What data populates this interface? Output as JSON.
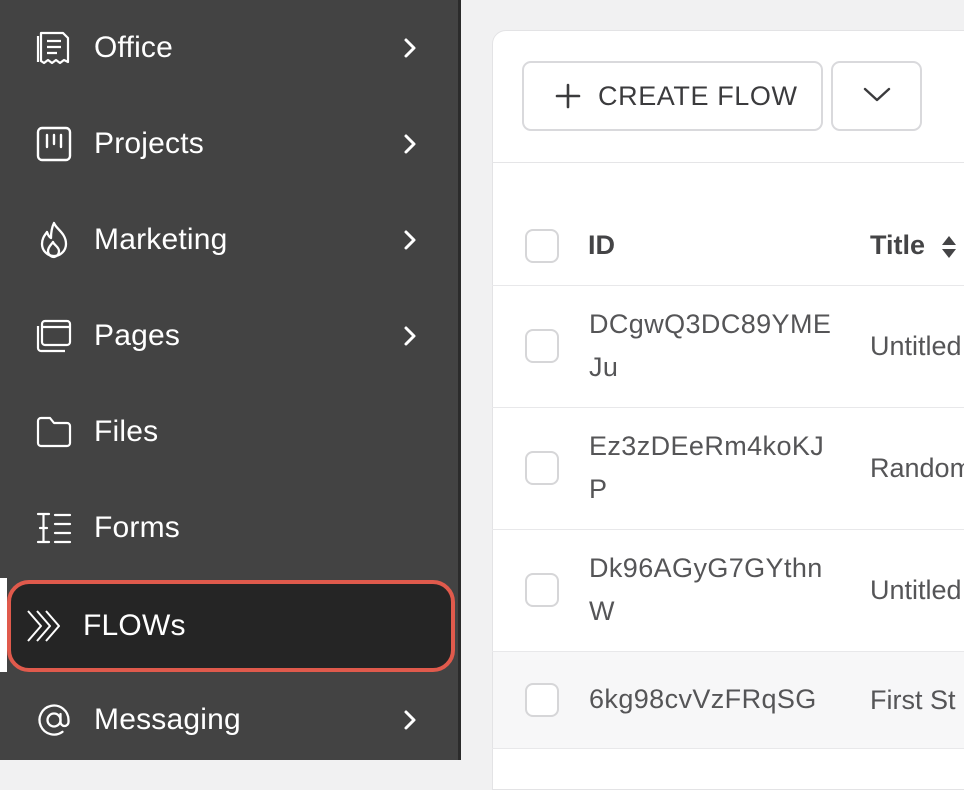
{
  "sidebar": {
    "items": [
      {
        "label": "Office",
        "icon": "office-document-icon",
        "has_submenu": true
      },
      {
        "label": "Projects",
        "icon": "projects-board-icon",
        "has_submenu": true
      },
      {
        "label": "Marketing",
        "icon": "flame-icon",
        "has_submenu": true
      },
      {
        "label": "Pages",
        "icon": "pages-icon",
        "has_submenu": true
      },
      {
        "label": "Files",
        "icon": "folder-icon",
        "has_submenu": false
      },
      {
        "label": "Forms",
        "icon": "forms-list-icon",
        "has_submenu": false
      },
      {
        "label": "FLOWs",
        "icon": "flows-chevrons-icon",
        "has_submenu": false,
        "active": true
      },
      {
        "label": "Messaging",
        "icon": "at-sign-icon",
        "has_submenu": true
      }
    ],
    "highlight_color": "#e05a4c"
  },
  "toolbar": {
    "create_label": "CREATE FLOW"
  },
  "table": {
    "headers": {
      "id": "ID",
      "title": "Title"
    },
    "rows": [
      {
        "id": "DCgwQ3DC89YMEJu",
        "title": "Untitled"
      },
      {
        "id": "Ez3zDEeRm4koKJP",
        "title": "Random"
      },
      {
        "id": "Dk96AGyG7GYthnW",
        "title": "Untitled"
      },
      {
        "id": "6kg98cvVzFRqSG",
        "title": "First St"
      }
    ]
  }
}
